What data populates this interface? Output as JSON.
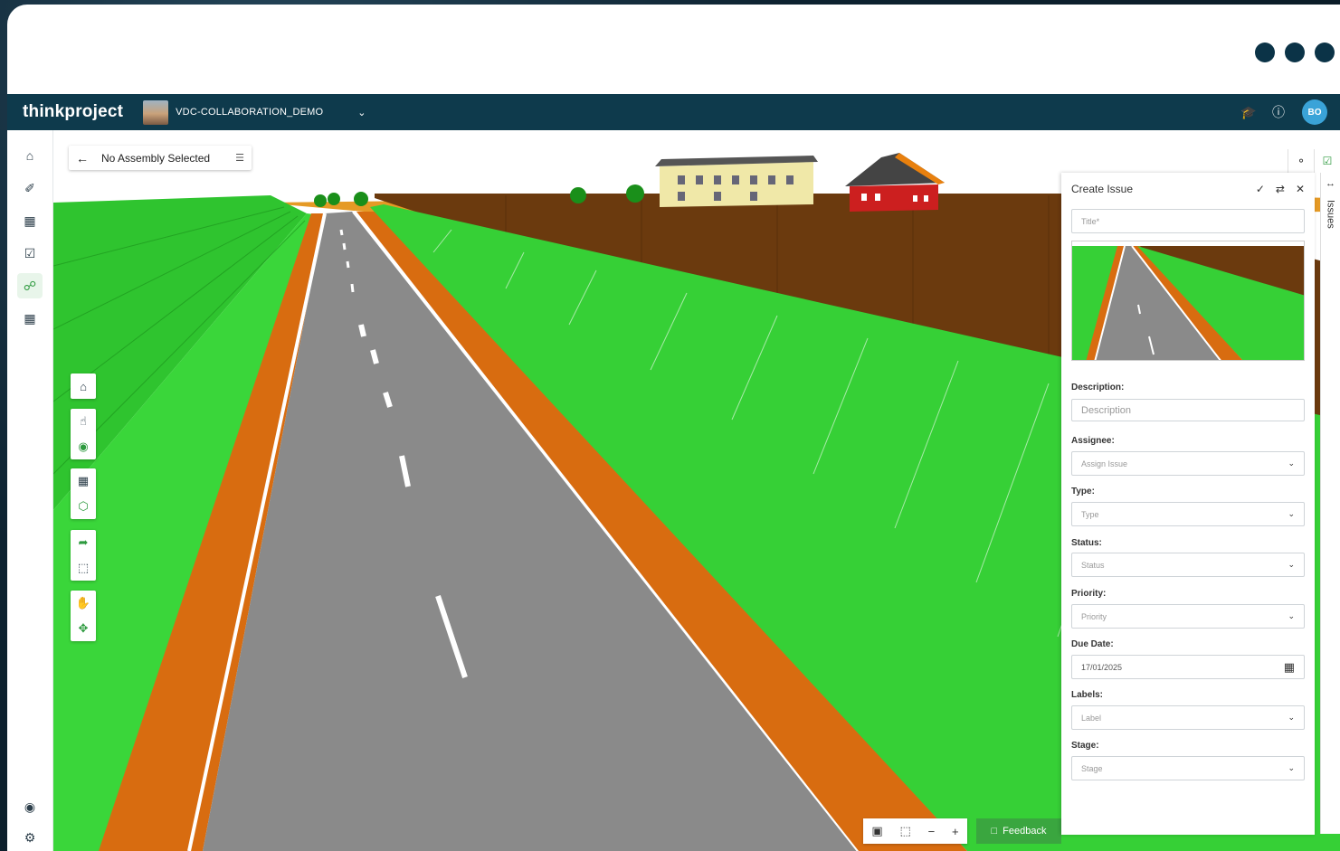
{
  "app": {
    "logo": "thinkproject",
    "project_name": "VDC-COLLABORATION_DEMO",
    "avatar_initials": "BO"
  },
  "viewer": {
    "assembly_label": "No Assembly Selected",
    "feedback_label": "Feedback"
  },
  "issue_panel": {
    "title": "Create Issue",
    "side_tab_label": "Issues",
    "title_placeholder": "Title*",
    "description_label": "Description:",
    "description_placeholder": "Description",
    "assignee_label": "Assignee:",
    "assignee_placeholder": "Assign Issue",
    "type_label": "Type:",
    "type_placeholder": "Type",
    "status_label": "Status:",
    "status_placeholder": "Status",
    "priority_label": "Priority:",
    "priority_placeholder": "Priority",
    "due_label": "Due Date:",
    "due_value": "17/01/2025",
    "labels_label": "Labels:",
    "labels_placeholder": "Label",
    "stage_label": "Stage:",
    "stage_placeholder": "Stage"
  },
  "colors": {
    "topbar": "#0e3a4c",
    "accent_green": "#3aa63f",
    "avatar": "#3aa3d8"
  }
}
